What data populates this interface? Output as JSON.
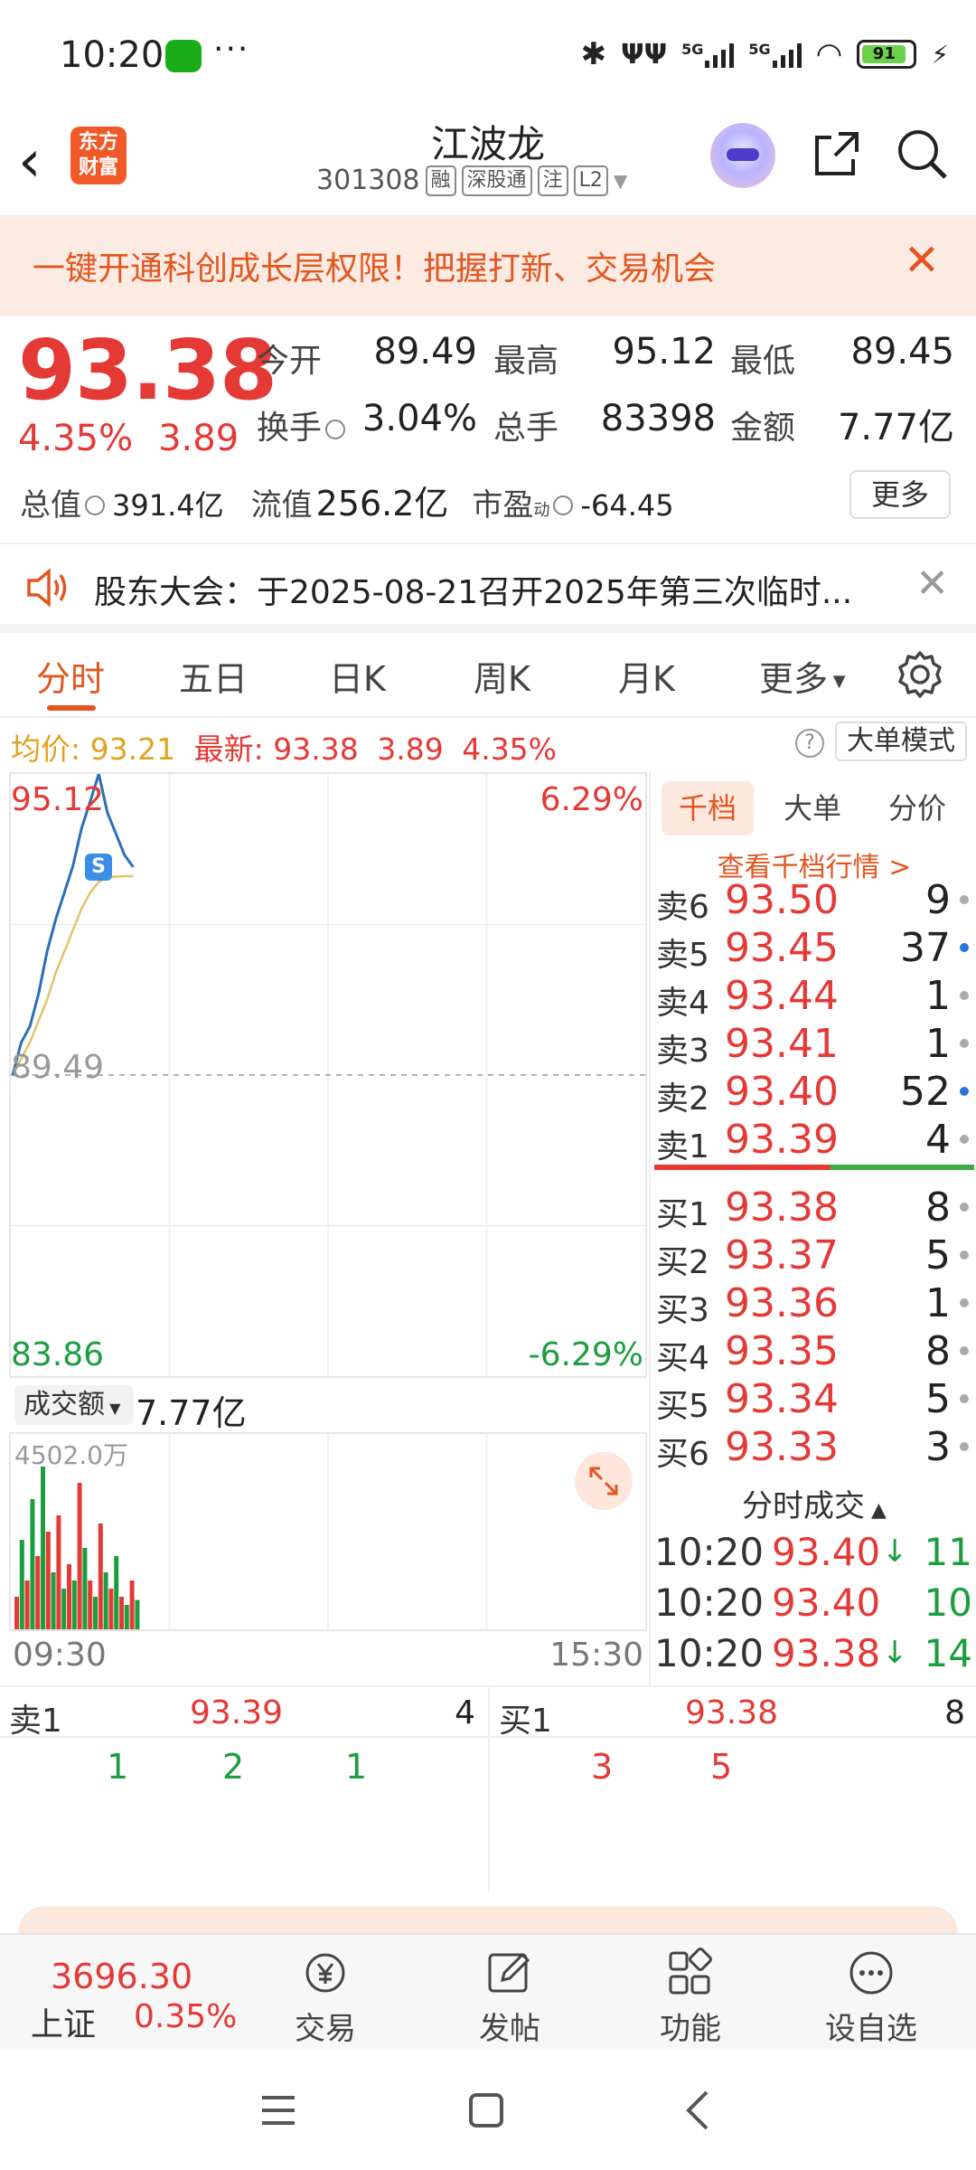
{
  "status": {
    "time": "10:20",
    "dots": "···",
    "sig1": "5G",
    "sig2": "5G",
    "battery": "91"
  },
  "header": {
    "logo_text": "东方财富",
    "title": "江波龙",
    "code": "301308",
    "tags": [
      "融",
      "深股通",
      "注",
      "L2"
    ]
  },
  "banner": {
    "text": "一键开通科创成长层权限！把握打新、交易机会",
    "close": "✕"
  },
  "quote": {
    "price": "93.38",
    "change_pct": "4.35%",
    "change_amt": "3.89",
    "fields": [
      {
        "label": "今开",
        "value": "89.49",
        "color": "#222"
      },
      {
        "label": "最高",
        "value": "95.12",
        "color": "#e53935"
      },
      {
        "label": "最低",
        "value": "89.45",
        "color": "#1b9e3e"
      },
      {
        "label": "换手",
        "value": "3.04%",
        "color": "#222"
      },
      {
        "label": "总手",
        "value": "83398",
        "color": "#222"
      },
      {
        "label": "金额",
        "value": "7.77亿",
        "color": "#222"
      }
    ],
    "mkt_total_label": "总值",
    "mkt_total": "391.4亿",
    "mkt_float_label": "流值",
    "mkt_float": "256.2亿",
    "pe_label": "市盈",
    "pe_sup": "动",
    "pe": "-64.45",
    "more": "更多"
  },
  "notice": {
    "text": "股东大会：于2025-08-21召开2025年第三次临时...",
    "close": "✕"
  },
  "tabs": [
    "分时",
    "五日",
    "日K",
    "周K",
    "月K",
    "更多"
  ],
  "inforow": {
    "avg_label": "均价:",
    "avg": "93.21",
    "last_label": "最新:",
    "last": "93.38",
    "chg": "3.89",
    "pct": "4.35%",
    "help": "?",
    "mode": "大单模式"
  },
  "chart": {
    "high_label": "95.12",
    "pct_top": "6.29%",
    "mid_label": "89.49",
    "low_label": "83.86",
    "pct_bottom": "-6.29%",
    "marker": "S"
  },
  "volume": {
    "selector": "成交额",
    "amount": "7.77亿",
    "max_label": "4502.0万",
    "time_start": "09:30",
    "time_end": "15:30"
  },
  "panel": {
    "tabs": [
      "千档",
      "大单",
      "分价"
    ],
    "link": "查看千档行情 >",
    "asks": [
      {
        "label": "卖6",
        "price": "93.50",
        "qty": "9",
        "dot": "gray"
      },
      {
        "label": "卖5",
        "price": "93.45",
        "qty": "37",
        "dot": "blue"
      },
      {
        "label": "卖4",
        "price": "93.44",
        "qty": "1",
        "dot": "gray"
      },
      {
        "label": "卖3",
        "price": "93.41",
        "qty": "1",
        "dot": "gray"
      },
      {
        "label": "卖2",
        "price": "93.40",
        "qty": "52",
        "dot": "blue"
      },
      {
        "label": "卖1",
        "price": "93.39",
        "qty": "4",
        "dot": "gray"
      }
    ],
    "bids": [
      {
        "label": "买1",
        "price": "93.38",
        "qty": "8",
        "dot": "gray"
      },
      {
        "label": "买2",
        "price": "93.37",
        "qty": "5",
        "dot": "gray"
      },
      {
        "label": "买3",
        "price": "93.36",
        "qty": "1",
        "dot": "gray"
      },
      {
        "label": "买4",
        "price": "93.35",
        "qty": "8",
        "dot": "gray"
      },
      {
        "label": "买5",
        "price": "93.34",
        "qty": "5",
        "dot": "gray"
      },
      {
        "label": "买6",
        "price": "93.33",
        "qty": "3",
        "dot": "gray"
      }
    ],
    "ticks_title": "分时成交",
    "ticks": [
      {
        "time": "10:20",
        "price": "93.40",
        "arrow": "↓",
        "vol": "11"
      },
      {
        "time": "10:20",
        "price": "93.40",
        "arrow": "",
        "vol": "10"
      },
      {
        "time": "10:20",
        "price": "93.38",
        "arrow": "↓",
        "vol": "14"
      }
    ]
  },
  "bidask": {
    "ask_label": "卖1",
    "ask_price": "93.39",
    "ask_qty": "4",
    "ask_queue": [
      "1",
      "2",
      "1"
    ],
    "bid_label": "买1",
    "bid_price": "93.38",
    "bid_qty": "8",
    "bid_queue": [
      "3",
      "5"
    ]
  },
  "bottomnav": {
    "index_value": "3696.30",
    "index_name": "上证",
    "index_pct": "0.35%",
    "items": [
      "交易",
      "发帖",
      "功能",
      "设自选"
    ]
  },
  "colors": {
    "up": "#e53935",
    "down": "#1b9e3e",
    "accent": "#e2561f",
    "price_line": "#2a6fb8",
    "avg_line": "#e2c26a"
  },
  "chart_data": {
    "type": "line",
    "series": [
      {
        "values": [
          89.49,
          90.1,
          90.4,
          91.0,
          91.8,
          92.4,
          92.9,
          93.4,
          94.1,
          94.6,
          95.12,
          94.4,
          94.0,
          93.6,
          93.38
        ]
      },
      {
        "values": [
          89.49,
          89.8,
          90.1,
          90.5,
          90.9,
          91.4,
          91.8,
          92.2,
          92.6,
          92.9,
          93.1,
          93.2,
          93.2,
          93.21,
          93.21
        ]
      }
    ],
    "ylim": [
      83.86,
      95.12
    ],
    "volume": [
      20,
      55,
      30,
      80,
      45,
      100,
      60,
      35,
      70,
      25,
      40,
      30,
      90,
      50,
      30,
      20,
      65,
      35,
      25,
      45,
      20,
      15,
      30,
      18
    ]
  }
}
